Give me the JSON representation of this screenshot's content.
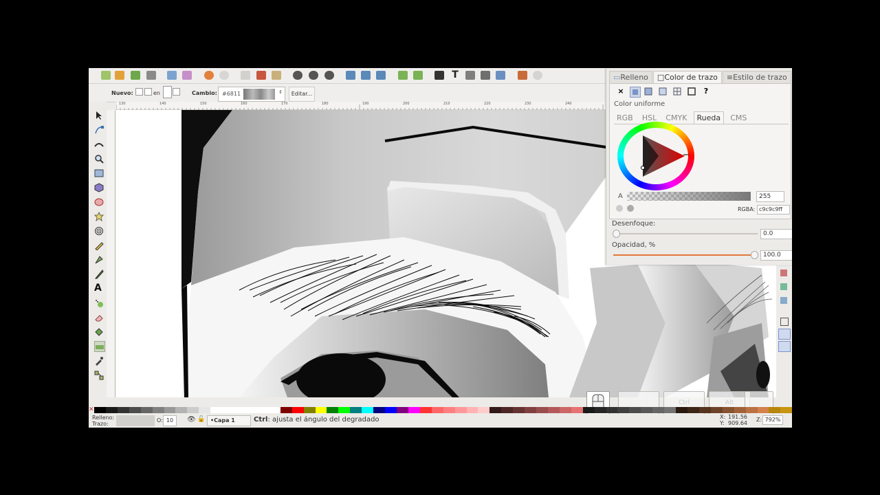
{
  "toolbar2": {
    "nuevo_label": "Nuevo:",
    "en_label": "en",
    "cambio_label": "Cambio:",
    "stop_value": "#6811",
    "edit_label": "Editar..."
  },
  "ruler": {
    "ticks": [
      "130",
      "140",
      "150",
      "160",
      "170",
      "180",
      "190",
      "200",
      "210",
      "220",
      "230",
      "240"
    ]
  },
  "fill_stroke": {
    "tabs": [
      "Relleno",
      "Color de trazo",
      "Estilo de trazo"
    ],
    "active_tab": "Color de trazo",
    "mode_unset": "×",
    "mode_unknown": "?",
    "section_label": "Color uniforme",
    "color_tabs": [
      "RGB",
      "HSL",
      "CMYK",
      "Rueda",
      "CMS"
    ],
    "active_color_tab": "Rueda",
    "alpha_label": "A",
    "alpha_value": "255",
    "rgba_label": "RGBA:",
    "rgba_value": "c9c9c9ff",
    "blur_label": "Desenfoque:",
    "blur_value": "0.0",
    "opacity_label": "Opacidad, %",
    "opacity_value": "100.0",
    "opacity_level": 1.0
  },
  "status": {
    "fill_label": "Relleno:",
    "stroke_label": "Trazo:",
    "opacity_short": "O:",
    "opacity_value": "10",
    "layer": "•Capa 1",
    "hint_key": "Ctrl",
    "hint_text": ": ajusta el ángulo del degradado",
    "coord_x_label": "X:",
    "coord_x": "191.56",
    "coord_y_label": "Y:",
    "coord_y": "909.64",
    "zoom_label": "Z:",
    "zoom_value": "792%"
  },
  "keys": {
    "ctrl": "Ctrl",
    "alt": "Alt"
  },
  "palette_colors": [
    "#000000",
    "#1a1a1a",
    "#333333",
    "#4d4d4d",
    "#666666",
    "#808080",
    "#999999",
    "#b3b3b3",
    "#cccccc",
    "#e6e6e6",
    "#ffffff",
    "#ffffff",
    "#ffffff",
    "#ffffff",
    "#ffffff",
    "#ffffff",
    "#800000",
    "#ff0000",
    "#808000",
    "#ffff00",
    "#008000",
    "#00ff00",
    "#008080",
    "#00ffff",
    "#000080",
    "#0000ff",
    "#800080",
    "#ff00ff",
    "#ff3333",
    "#ff6666",
    "#ff8080",
    "#ff9999",
    "#ffb3b3",
    "#ffcccc",
    "#331a1a",
    "#4d2626",
    "#663333",
    "#804040",
    "#994d4d",
    "#b35959",
    "#cc6666",
    "#e67373",
    "#1a1a1a",
    "#262626",
    "#333333",
    "#404040",
    "#4d4d4d",
    "#595959",
    "#666666",
    "#737373",
    "#2b1a0f",
    "#3d2616",
    "#55341e",
    "#6e4327",
    "#885330",
    "#a1623a",
    "#bb7243",
    "#d4824c",
    "#b8860b",
    "#c89510"
  ]
}
